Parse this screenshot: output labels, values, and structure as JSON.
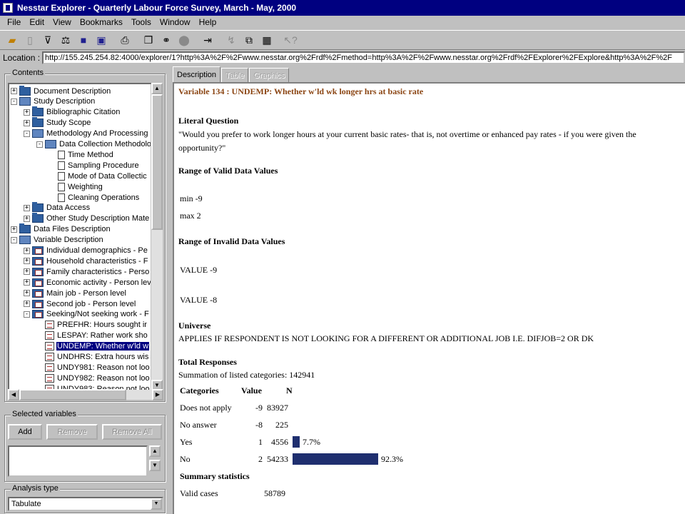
{
  "window": {
    "title": "Nesstar Explorer - Quarterly Labour Force Survey, March - May, 2000"
  },
  "menu": [
    "File",
    "Edit",
    "View",
    "Bookmarks",
    "Tools",
    "Window",
    "Help"
  ],
  "location": {
    "label": "Location :",
    "url": "http://155.245.254.82:4000/explorer/1?http%3A%2F%2Fwww.nesstar.org%2Frdf%2Fmethod=http%3A%2F%2Fwww.nesstar.org%2Frdf%2FExplorer%2FExplore&http%3A%2F%2F"
  },
  "contents": {
    "title": "Contents",
    "tree": [
      {
        "label": "Document Description",
        "depth": 0,
        "exp": "+",
        "icon": "folder"
      },
      {
        "label": "Study Description",
        "depth": 0,
        "exp": "−",
        "icon": "folder-open"
      },
      {
        "label": "Bibliographic Citation",
        "depth": 1,
        "exp": "+",
        "icon": "folder"
      },
      {
        "label": "Study Scope",
        "depth": 1,
        "exp": "+",
        "icon": "folder"
      },
      {
        "label": "Methodology And Processing",
        "depth": 1,
        "exp": "−",
        "icon": "folder-open"
      },
      {
        "label": "Data Collection Methodolo",
        "depth": 2,
        "exp": "−",
        "icon": "folder-open"
      },
      {
        "label": "Time Method",
        "depth": 3,
        "exp": "",
        "icon": "page"
      },
      {
        "label": "Sampling Procedure",
        "depth": 3,
        "exp": "",
        "icon": "page"
      },
      {
        "label": "Mode of Data Collectic",
        "depth": 3,
        "exp": "",
        "icon": "page"
      },
      {
        "label": "Weighting",
        "depth": 3,
        "exp": "",
        "icon": "page"
      },
      {
        "label": "Cleaning Operations",
        "depth": 3,
        "exp": "",
        "icon": "page"
      },
      {
        "label": "Data Access",
        "depth": 1,
        "exp": "+",
        "icon": "folder"
      },
      {
        "label": "Other Study Description Mate",
        "depth": 1,
        "exp": "+",
        "icon": "folder"
      },
      {
        "label": "Data Files Description",
        "depth": 0,
        "exp": "+",
        "icon": "folder"
      },
      {
        "label": "Variable Description",
        "depth": 0,
        "exp": "−",
        "icon": "folder-open"
      },
      {
        "label": "Individual demographics - Pe",
        "depth": 1,
        "exp": "+",
        "icon": "varset"
      },
      {
        "label": "Household characteristics - F",
        "depth": 1,
        "exp": "+",
        "icon": "varset"
      },
      {
        "label": "Family characteristics - Perso",
        "depth": 1,
        "exp": "+",
        "icon": "varset"
      },
      {
        "label": "Economic activity - Person lev",
        "depth": 1,
        "exp": "+",
        "icon": "varset"
      },
      {
        "label": "Main job - Person level",
        "depth": 1,
        "exp": "+",
        "icon": "varset"
      },
      {
        "label": "Second job - Person level",
        "depth": 1,
        "exp": "+",
        "icon": "varset"
      },
      {
        "label": "Seeking/Not seeking work - F",
        "depth": 1,
        "exp": "−",
        "icon": "varset"
      },
      {
        "label": "PREFHR: Hours sought ir",
        "depth": 2,
        "exp": "",
        "icon": "var"
      },
      {
        "label": "LESPAY: Rather work sho",
        "depth": 2,
        "exp": "",
        "icon": "var"
      },
      {
        "label": "UNDEMP: Whether w'ld w",
        "depth": 2,
        "exp": "",
        "icon": "var",
        "selected": true
      },
      {
        "label": "UNDHRS: Extra hours wis",
        "depth": 2,
        "exp": "",
        "icon": "var"
      },
      {
        "label": "UNDY981: Reason not loo",
        "depth": 2,
        "exp": "",
        "icon": "var"
      },
      {
        "label": "UNDY982: Reason not loo",
        "depth": 2,
        "exp": "",
        "icon": "var"
      },
      {
        "label": "UNDY983: Reason not loo",
        "depth": 2,
        "exp": "",
        "icon": "var"
      }
    ]
  },
  "selected_variables": {
    "title": "Selected variables",
    "add": "Add",
    "remove": "Remove",
    "remove_all": "Remove All"
  },
  "analysis": {
    "title": "Analysis type",
    "value": "Tabulate"
  },
  "tabs": [
    {
      "label": "Description",
      "active": true
    },
    {
      "label": "Table",
      "active": false
    },
    {
      "label": "Graphics",
      "active": false
    }
  ],
  "doc": {
    "var_title": "Variable 134 : UNDEMP: Whether w'ld wk longer hrs at basic rate",
    "literal_question_title": "Literal Question",
    "literal_question_line1": "\"Would you prefer to work longer hours at your current basic rates- that is, not overtime or enhanced pay rates - if you were given the",
    "literal_question_line2": "opportunity?\"",
    "valid_title": "Range of Valid Data Values",
    "valid_min": "min  -9",
    "valid_max": "max  2",
    "invalid_title": "Range of Invalid Data Values",
    "invalid_1": "VALUE  -9",
    "invalid_2": "VALUE  -8",
    "universe_title": "Universe",
    "universe_text": "APPLIES IF RESPONDENT IS NOT LOOKING FOR A DIFFERENT OR ADDITIONAL JOB I.E. DIFJOB=2 OR DK",
    "total_title": "Total Responses",
    "total_text": "Summation of listed categories: 142941",
    "table_headers": [
      "Categories",
      "Value",
      "N"
    ],
    "rows": [
      {
        "cat": "Does not apply",
        "value": "-9",
        "n": "83927",
        "pct": "",
        "frac": 0
      },
      {
        "cat": "No answer",
        "value": "-8",
        "n": "225",
        "pct": "",
        "frac": 0
      },
      {
        "cat": "Yes",
        "value": "1",
        "n": "4556",
        "pct": "7.7%",
        "frac": 0.077
      },
      {
        "cat": "No",
        "value": "2",
        "n": "54233",
        "pct": "92.3%",
        "frac": 0.923
      }
    ],
    "summary_title": "Summary statistics",
    "valid_cases_label": "Valid cases",
    "valid_cases_value": "58789"
  }
}
